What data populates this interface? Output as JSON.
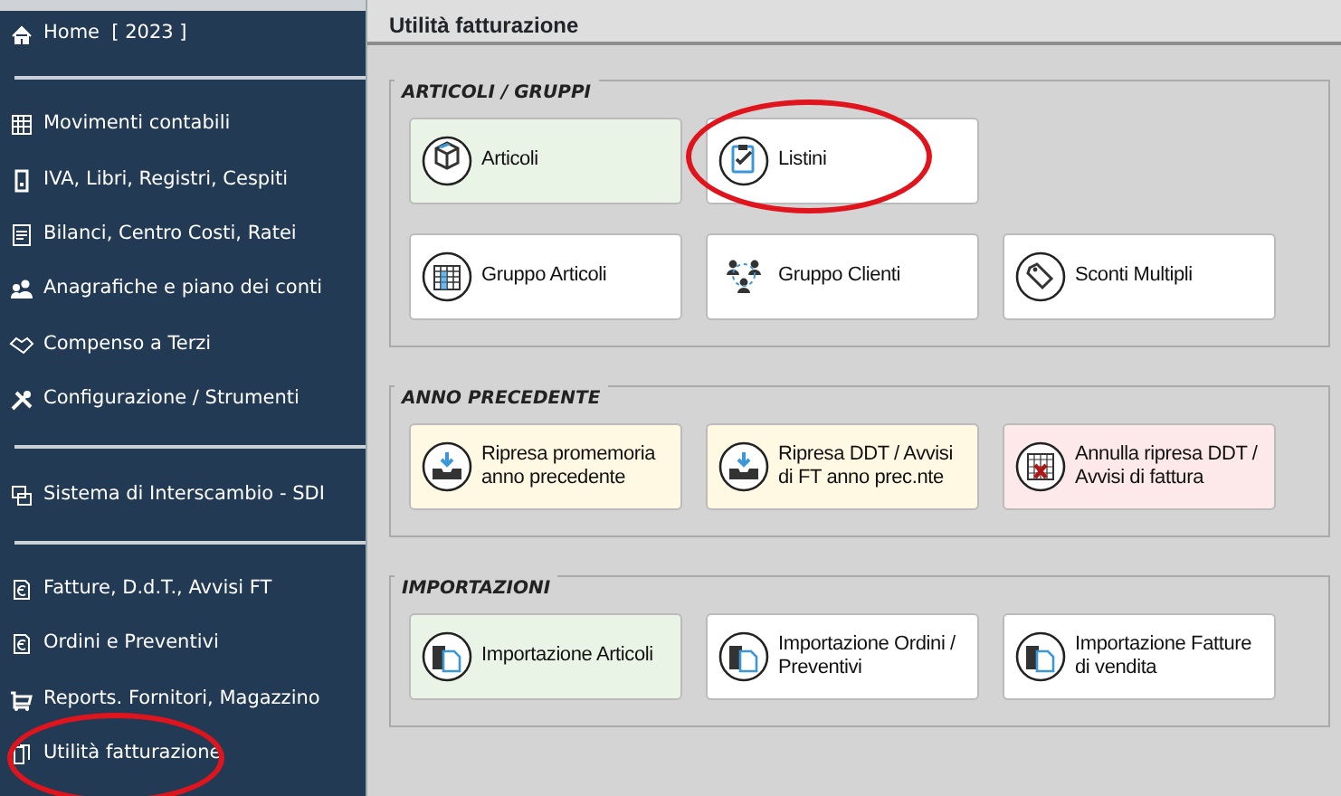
{
  "sidebar": {
    "groups": [
      {
        "items": [
          {
            "label": "Home  [ 2023 ]",
            "circled": false
          }
        ]
      },
      {
        "items": [
          {
            "label": "Movimenti contabili",
            "circled": false
          },
          {
            "label": "IVA, Libri, Registri, Cespiti",
            "circled": false
          },
          {
            "label": "Bilanci, Centro Costi, Ratei",
            "circled": false
          },
          {
            "label": "Anagrafiche e piano dei conti",
            "circled": false
          },
          {
            "label": "Compenso a Terzi",
            "circled": false
          },
          {
            "label": "Configurazione / Strumenti",
            "circled": false
          }
        ]
      },
      {
        "items": [
          {
            "label": "Sistema di Interscambio - SDI",
            "circled": false
          }
        ]
      },
      {
        "items": [
          {
            "label": "Fatture, D.d.T., Avvisi FT",
            "circled": false
          },
          {
            "label": "Ordini e Preventivi",
            "circled": false
          },
          {
            "label": "Reports. Fornitori, Magazzino",
            "circled": false
          },
          {
            "label": "Utilità fatturazione",
            "circled": true
          }
        ]
      }
    ]
  },
  "page_title": "Utilità fatturazione",
  "sections": [
    {
      "title": "ARTICOLI / GRUPPI",
      "rows": [
        [
          {
            "label": "Articoli",
            "color": "#e9f4e6",
            "circled": false
          },
          {
            "label": "Listini",
            "color": "#ffffff",
            "circled": true
          }
        ],
        [
          {
            "label": "Gruppo Articoli",
            "color": "#ffffff",
            "circled": false
          },
          {
            "label": "Gruppo Clienti",
            "color": "#ffffff",
            "circled": false
          },
          {
            "label": "Sconti Multipli",
            "color": "#ffffff",
            "circled": false
          }
        ]
      ]
    },
    {
      "title": "ANNO PRECEDENTE",
      "rows": [
        [
          {
            "label": "Ripresa promemoria anno precedente",
            "color": "#fff8e3",
            "circled": false
          },
          {
            "label": "Ripresa DDT / Avvisi di FT anno prec.nte",
            "color": "#fff8e3",
            "circled": false
          },
          {
            "label": "Annulla ripresa DDT / Avvisi di fattura",
            "color": "#fde9e9",
            "circled": false
          }
        ]
      ]
    },
    {
      "title": "IMPORTAZIONI",
      "rows": [
        [
          {
            "label": "Importazione Articoli",
            "color": "#e9f4e6",
            "circled": false
          },
          {
            "label": "Importazione Ordini / Preventivi",
            "color": "#ffffff",
            "circled": false
          },
          {
            "label": "Importazione Fatture di vendita",
            "color": "#ffffff",
            "circled": false
          }
        ]
      ]
    }
  ]
}
